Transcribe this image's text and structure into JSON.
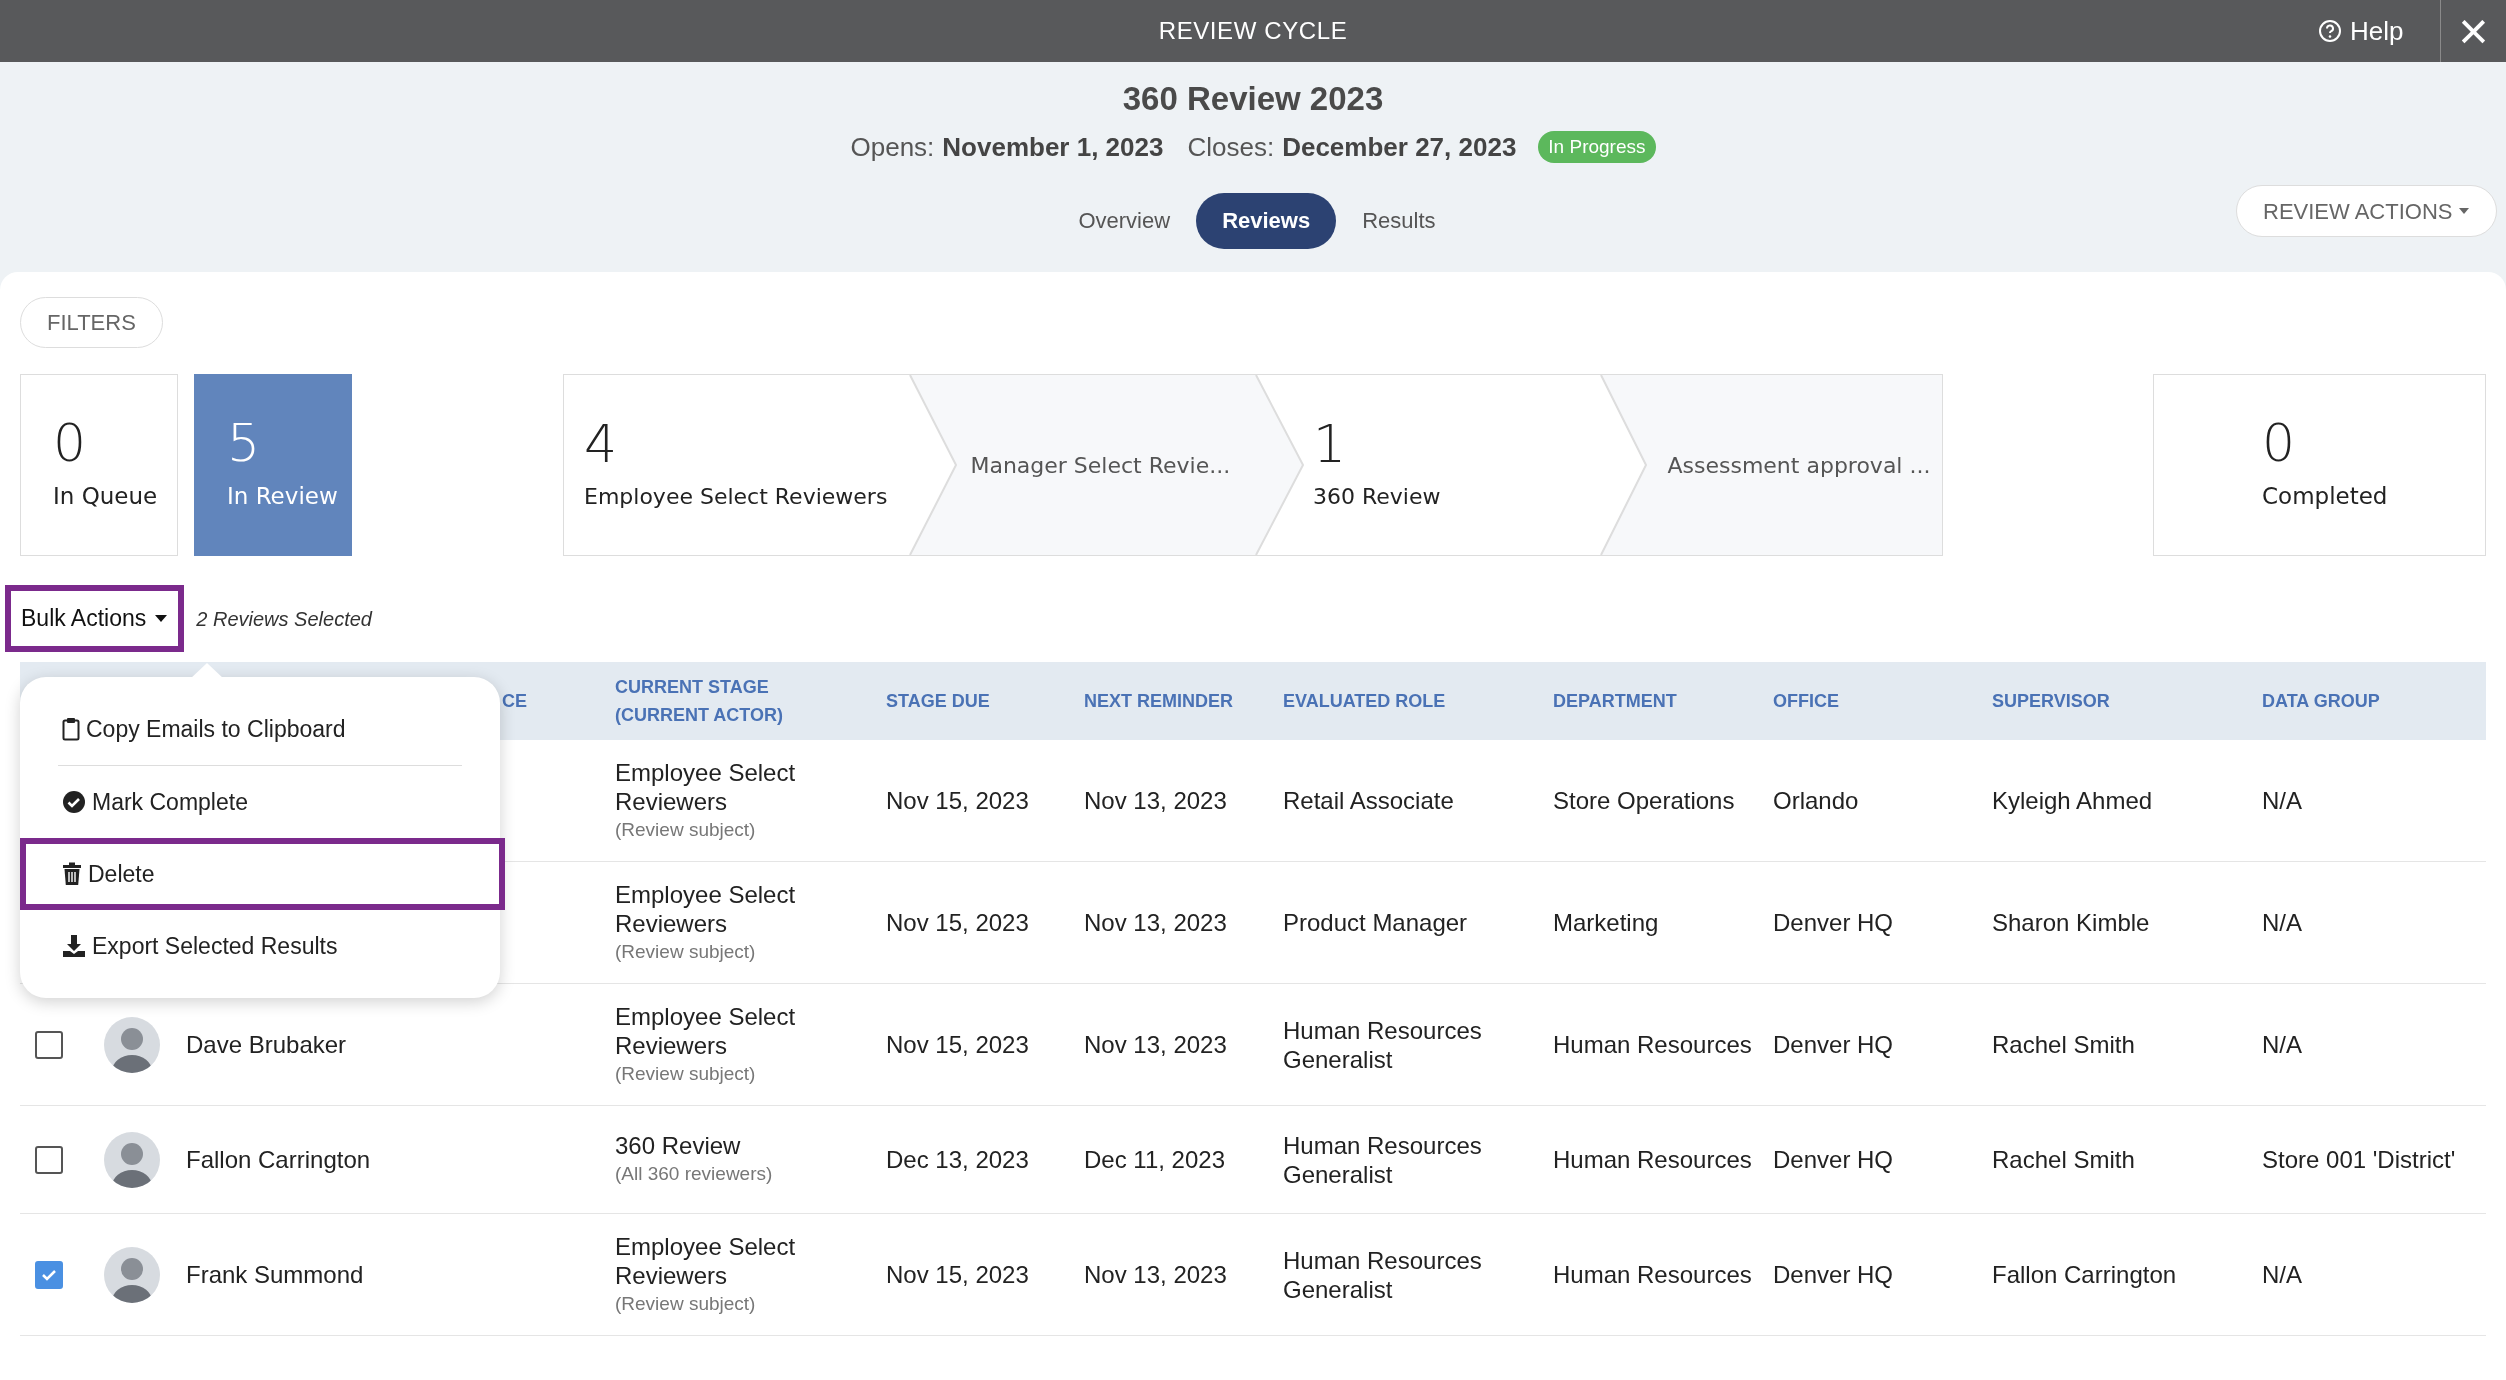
{
  "window": {
    "title": "REVIEW CYCLE",
    "help": "Help",
    "close": "×"
  },
  "cycle": {
    "title": "360 Review 2023",
    "opens_label": "Opens:",
    "opens": "November 1, 2023",
    "closes_label": "Closes:",
    "closes": "December 27, 2023",
    "status": "In Progress"
  },
  "tabs": [
    {
      "label": "Overview",
      "selected": false
    },
    {
      "label": "Reviews",
      "selected": true
    },
    {
      "label": "Results",
      "selected": false
    }
  ],
  "review_actions": "REVIEW ACTIONS",
  "filters": "FILTERS",
  "queue_cards": [
    {
      "count": "0",
      "label": "In Queue",
      "selected": false
    },
    {
      "count": "5",
      "label": "In Review",
      "selected": true
    }
  ],
  "stages": [
    {
      "kind": "active",
      "count": "4",
      "label": "Employee Select Reviewers"
    },
    {
      "kind": "pending",
      "label": "Manager Select Revie..."
    },
    {
      "kind": "active",
      "count": "1",
      "label": "360 Review"
    },
    {
      "kind": "pending",
      "label": "Assessment approval ..."
    }
  ],
  "completed": {
    "count": "0",
    "label": "Completed"
  },
  "bulk_actions": {
    "label": "Bulk Actions",
    "highlighted": true,
    "selected_count": "2 Reviews Selected"
  },
  "bulk_menu": [
    {
      "label": "Copy Emails to Clipboard",
      "highlighted": false,
      "separator_after": true
    },
    {
      "label": "Mark Complete",
      "highlighted": false,
      "separator_after": false
    },
    {
      "label": "Delete",
      "highlighted": true,
      "separator_after": false
    },
    {
      "label": "Export Selected Results",
      "highlighted": false,
      "separator_after": false
    }
  ],
  "table": {
    "columns": [
      "CE",
      "CURRENT STAGE (CURRENT ACTOR)",
      "STAGE DUE",
      "NEXT REMINDER",
      "EVALUATED ROLE",
      "DEPARTMENT",
      "OFFICE",
      "SUPERVISOR",
      "DATA GROUP"
    ],
    "rows": [
      {
        "stage": "Employee Select Reviewers",
        "stage_note": "(Review subject)",
        "stage_due": "Nov 15, 2023",
        "next_reminder": "Nov 13, 2023",
        "role": "Retail Associate",
        "department": "Store Operations",
        "office": "Orlando",
        "supervisor": "Kyleigh Ahmed",
        "data_group": "N/A"
      },
      {
        "stage": "Employee Select Reviewers",
        "stage_note": "(Review subject)",
        "stage_due": "Nov 15, 2023",
        "next_reminder": "Nov 13, 2023",
        "role": "Product Manager",
        "department": "Marketing",
        "office": "Denver HQ",
        "supervisor": "Sharon Kimble",
        "data_group": "N/A"
      },
      {
        "checked": false,
        "name": "Dave Brubaker",
        "stage": "Employee Select Reviewers",
        "stage_note": "(Review subject)",
        "stage_due": "Nov 15, 2023",
        "next_reminder": "Nov 13, 2023",
        "role": "Human Resources Generalist",
        "department": "Human Resources",
        "office": "Denver HQ",
        "supervisor": "Rachel Smith",
        "data_group": "N/A"
      },
      {
        "checked": false,
        "name": "Fallon Carrington",
        "stage": "360 Review",
        "stage_note": "(All 360 reviewers)",
        "stage_due": "Dec 13, 2023",
        "next_reminder": "Dec 11, 2023",
        "role": "Human Resources Generalist",
        "department": "Human Resources",
        "office": "Denver HQ",
        "supervisor": "Rachel Smith",
        "data_group": "Store 001 'District'"
      },
      {
        "checked": true,
        "name": "Frank Summond",
        "stage": "Employee Select Reviewers",
        "stage_note": "(Review subject)",
        "stage_due": "Nov 15, 2023",
        "next_reminder": "Nov 13, 2023",
        "role": "Human Resources Generalist",
        "department": "Human Resources",
        "office": "Denver HQ",
        "supervisor": "Fallon Carrington",
        "data_group": "N/A"
      }
    ]
  }
}
